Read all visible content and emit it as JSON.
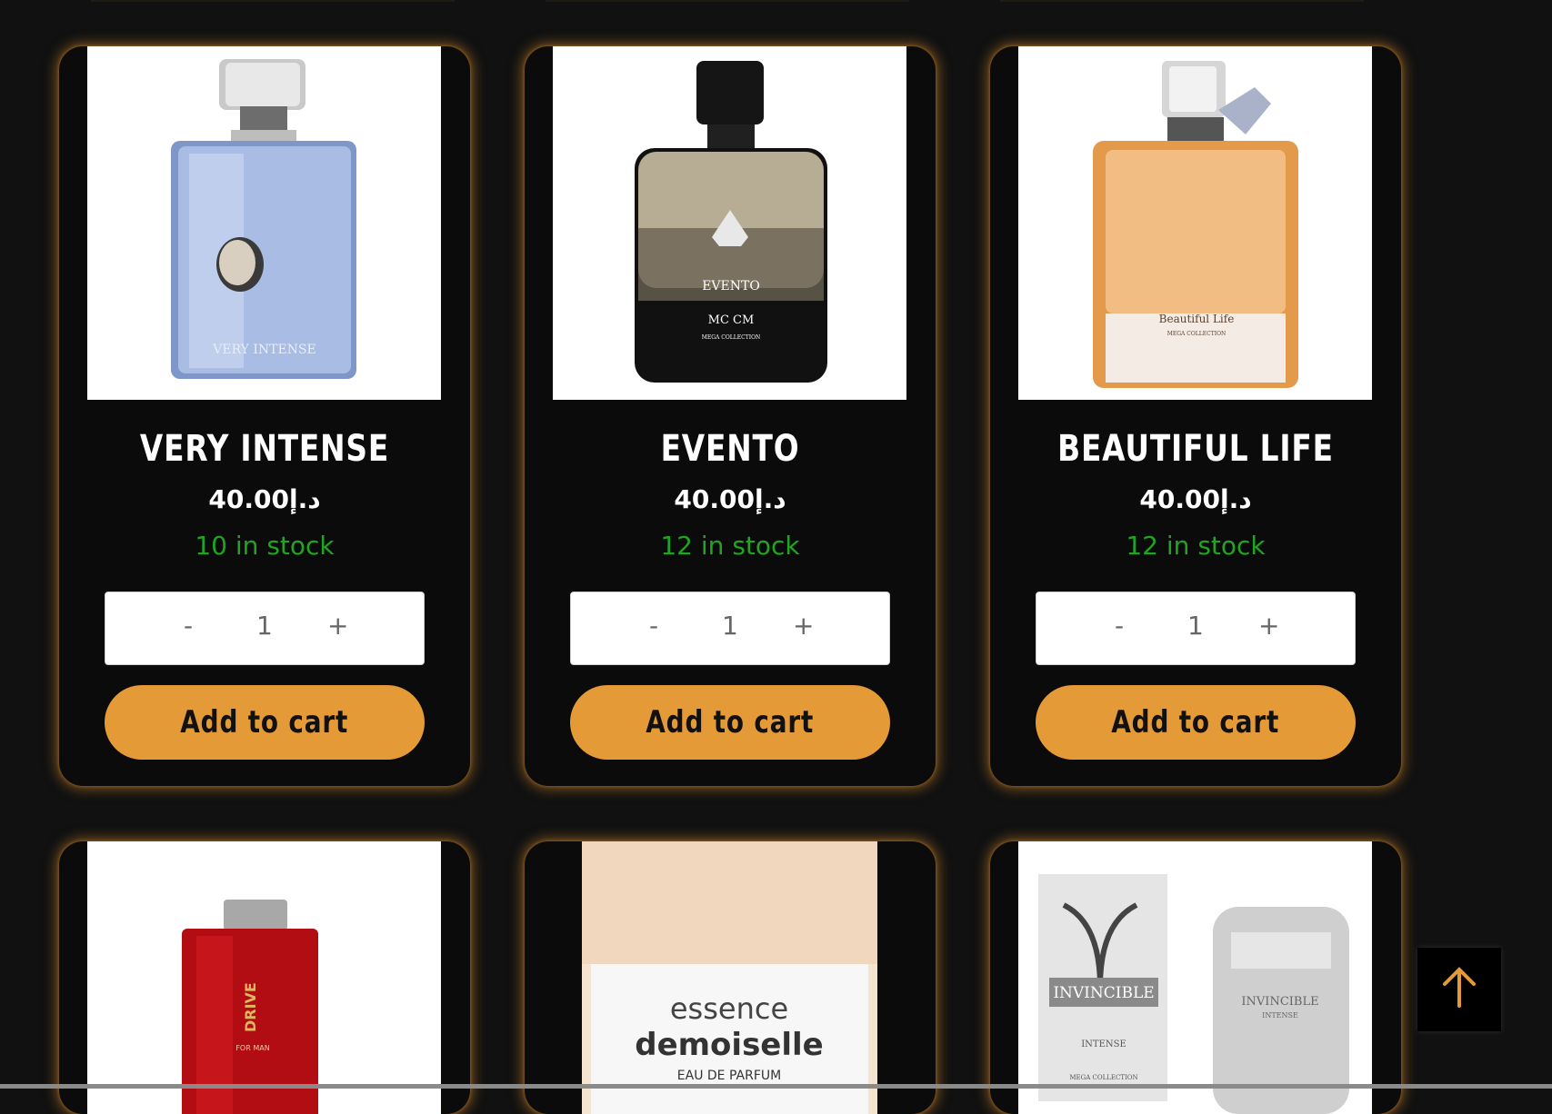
{
  "products": [
    {
      "name": "Very Intense",
      "price": "د.إ40.00",
      "stock": "10 in stock",
      "qty": "1",
      "minus": "-",
      "plus": "+",
      "add_label": "Add to cart",
      "bottle_text": "VERY INTENSE"
    },
    {
      "name": "Evento",
      "price": "د.إ40.00",
      "stock": "12 in stock",
      "qty": "1",
      "minus": "-",
      "plus": "+",
      "add_label": "Add to cart",
      "bottle_text": "EVENTO",
      "bottle_sub": "MC CM",
      "bottle_sub2": "MEGA COLLECTION"
    },
    {
      "name": "Beautiful Life",
      "price": "د.إ40.00",
      "stock": "12 in stock",
      "qty": "1",
      "minus": "-",
      "plus": "+",
      "add_label": "Add to cart",
      "bottle_text": "Beautiful Life",
      "bottle_sub": "MEGA COLLECTION"
    },
    {
      "bottle_text": "DRIVE",
      "bottle_sub": "FOR MAN"
    },
    {
      "bottle_text": "essence",
      "bottle_sub": "demoiselle",
      "bottle_sub2": "EAU DE PARFUM"
    },
    {
      "bottle_text": "INVINCIBLE",
      "bottle_sub": "INTENSE",
      "bottle_sub2": "MEGA COLLECTION",
      "bottle_text2": "INVINCIBLE",
      "bottle_sub3": "INTENSE"
    }
  ],
  "colors": {
    "accent": "#e59a38",
    "stock": "#1fa51f",
    "background": "#111111"
  },
  "scroll_top_icon": "arrow-up-icon"
}
